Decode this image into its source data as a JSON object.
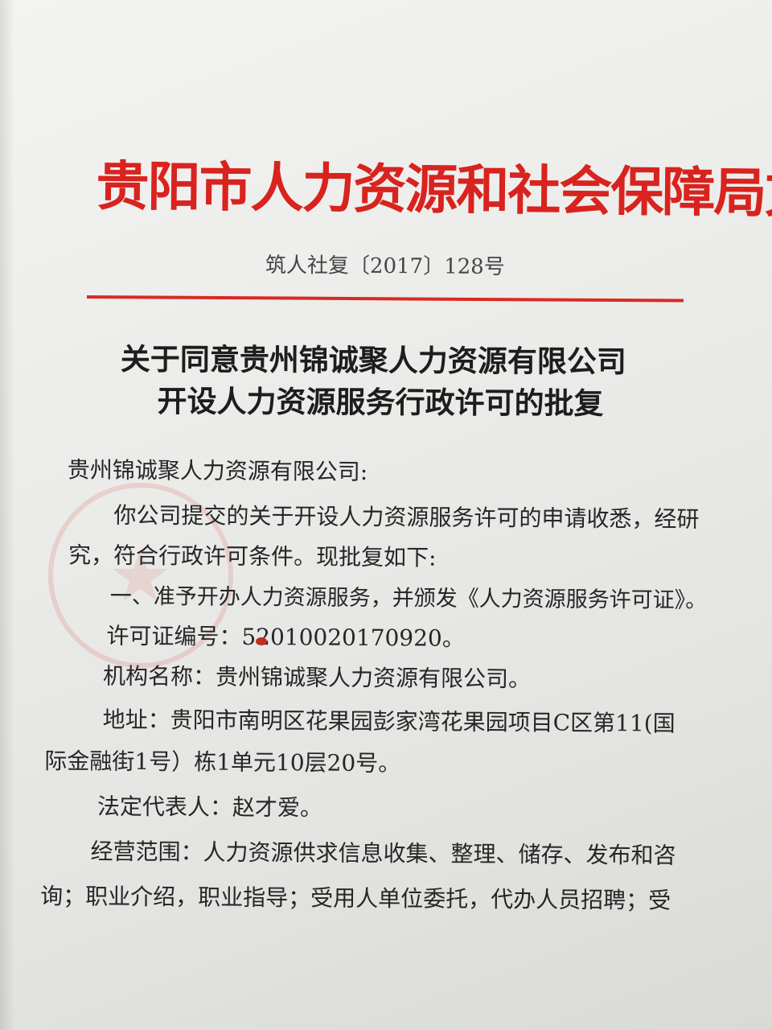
{
  "document": {
    "header": "贵阳市人力资源和社会保障局文件",
    "doc_number": "筑人社复〔2017〕128号",
    "subject_line1": "关于同意贵州锦诚聚人力资源有限公司",
    "subject_line2": "开设人力资源服务行政许可的批复",
    "salutation": "贵州锦诚聚人力资源有限公司:",
    "para1_line1": "你公司提交的关于开设人力资源服务许可的申请收悉，经研",
    "para1_line2": "究，符合行政许可条件。现批复如下:",
    "item1": "一、准予开办人力资源服务，并颁发《人力资源服务许可证》。",
    "license_no": "许可证编号：52010020170920。",
    "org_name": "机构名称：贵州锦诚聚人力资源有限公司。",
    "address_line1": "地址：贵阳市南明区花果园彭家湾花果园项目C区第11(国",
    "address_line2": "际金融街1号）栋1单元10层20号。",
    "legal_rep": "法定代表人：赵才爱。",
    "scope_line1": "经营范围：人力资源供求信息收集、整理、储存、发布和咨",
    "scope_line2": "询；职业介绍，职业指导；受用人单位委托，代办人员招聘；受"
  },
  "colors": {
    "header_red": "#d8231f",
    "rule_red": "#d92a24",
    "text": "#262626"
  }
}
